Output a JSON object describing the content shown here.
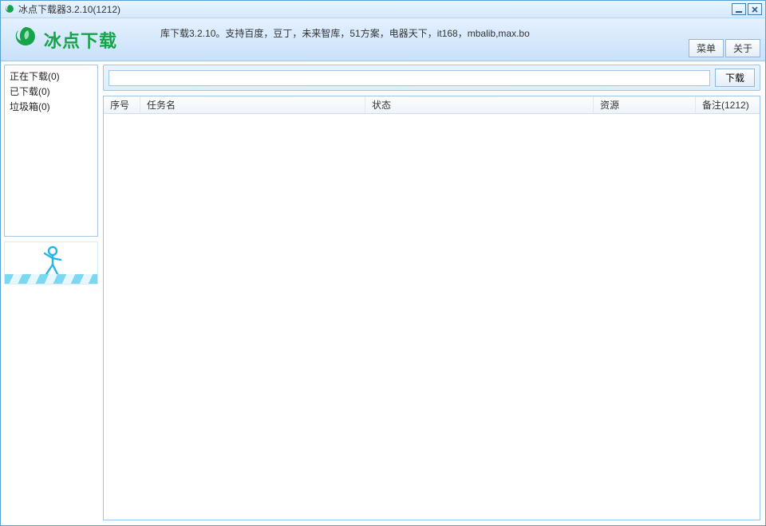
{
  "window": {
    "title": "冰点下载器3.2.10(1212)"
  },
  "header": {
    "brand": "冰点下载",
    "subtitle": "库下载3.2.10。支持百度，豆丁，未来智库，51方案，电器天下，it168，mbalib,max.bo",
    "menu_label": "菜单",
    "about_label": "关于"
  },
  "sidebar": {
    "items": [
      {
        "label": "正在下载(0)"
      },
      {
        "label": "已下载(0)"
      },
      {
        "label": "垃圾箱(0)"
      }
    ]
  },
  "url_bar": {
    "value": "",
    "download_label": "下载"
  },
  "table": {
    "columns": {
      "seq": "序号",
      "name": "任务名",
      "status": "状态",
      "resource": "资源",
      "note": "备注(1212)"
    },
    "rows": []
  },
  "colors": {
    "brand_green": "#16a349",
    "frame_blue": "#5a9fd4"
  }
}
